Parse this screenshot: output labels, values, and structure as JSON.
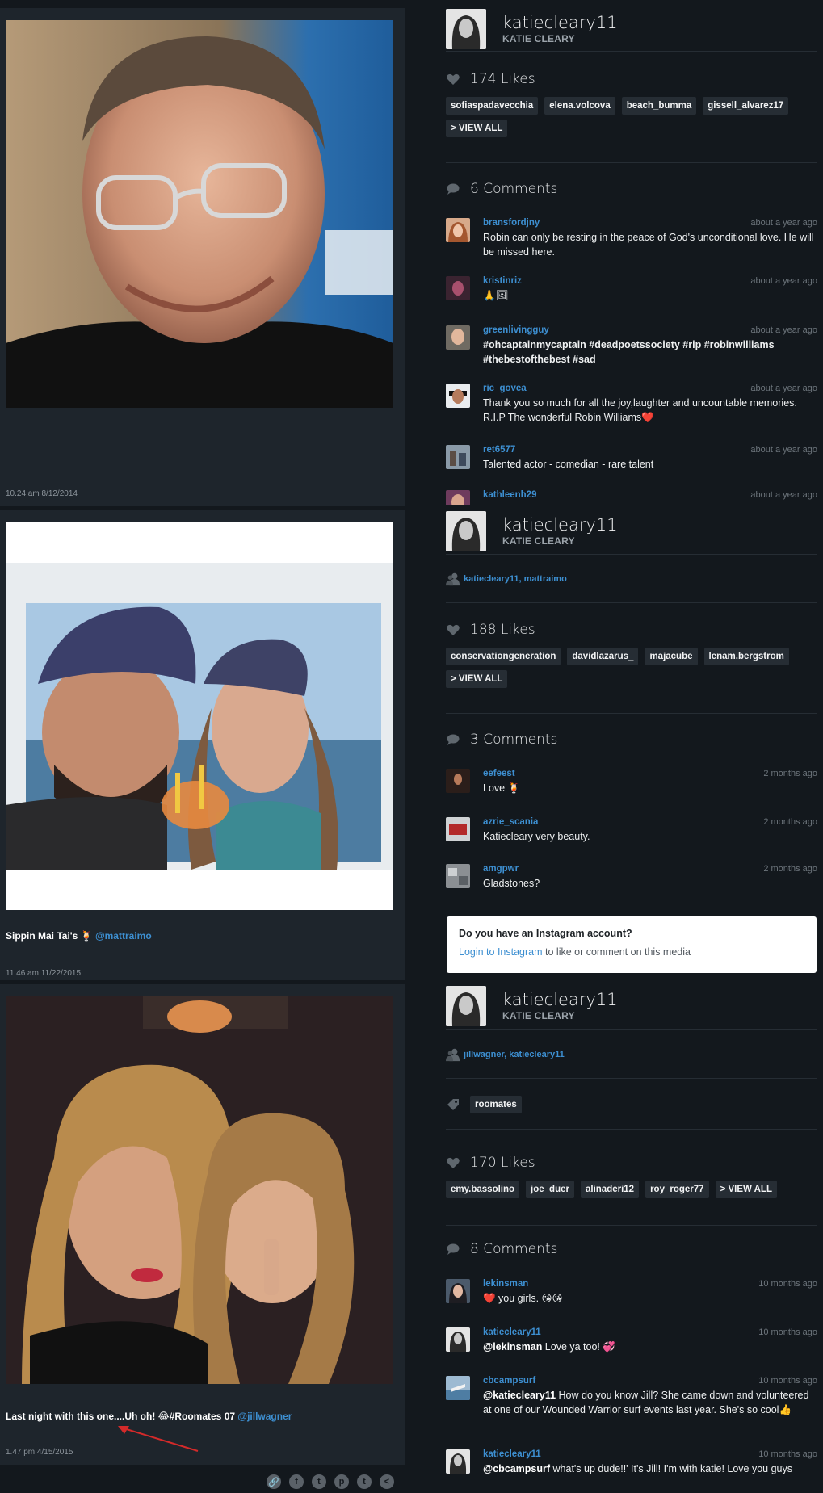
{
  "posts": [
    {
      "photo_alt": "Robin Williams portrait",
      "caption_text": "",
      "caption_mention": "",
      "timestamp": "10.24 am 8/12/2014",
      "profile": {
        "username": "katiecleary11",
        "fullname": "KATIE CLEARY"
      },
      "tagged_people": "",
      "tags": [],
      "likes_label": "174 Likes",
      "likers": [
        "sofiaspadavecchia",
        "elena.volcova",
        "beach_bumma",
        "gissell_alvarez17"
      ],
      "view_all": "> VIEW ALL",
      "comments_label": "6 Comments",
      "comments": [
        {
          "user": "bransfordjny",
          "time": "about a year ago",
          "text": "Robin can only be resting in the peace of God's unconditional love. He will be missed here."
        },
        {
          "user": "kristinriz",
          "time": "about a year ago",
          "text": "🙏🖼"
        },
        {
          "user": "greenlivingguy",
          "time": "about a year ago",
          "text": "#ohcaptainmycaptain #deadpoetssociety #rip #robinwilliams #thebestofthebest #sad"
        },
        {
          "user": "ric_govea",
          "time": "about a year ago",
          "text": "Thank you so much for all the joy,laughter and uncountable memories. R.I.P The wonderful Robin Williams❤️"
        },
        {
          "user": "ret6577",
          "time": "about a year ago",
          "text": "Talented actor - comedian - rare talent"
        },
        {
          "user": "kathleenh29",
          "time": "about a year ago",
          "text": ""
        }
      ]
    },
    {
      "photo_alt": "Selfie with mai tai",
      "caption_text": "Sippin Mai Tai's 🍹",
      "caption_mention": "@mattraimo",
      "timestamp": "11.46 am 11/22/2015",
      "profile": {
        "username": "katiecleary11",
        "fullname": "KATIE CLEARY"
      },
      "tagged_people": "katiecleary11, mattraimo",
      "tags": [],
      "likes_label": "188 Likes",
      "likers": [
        "conservationgeneration",
        "davidlazarus_",
        "majacube",
        "lenam.bergstrom"
      ],
      "view_all": "> VIEW ALL",
      "comments_label": "3 Comments",
      "comments": [
        {
          "user": "eefeest",
          "time": "2 months ago",
          "text": "Love 🍹"
        },
        {
          "user": "azrie_scania",
          "time": "2 months ago",
          "text": "Katiecleary very beauty."
        },
        {
          "user": "amgpwr",
          "time": "2 months ago",
          "text": "Gladstones?"
        }
      ],
      "login_prompt": {
        "question": "Do you have an Instagram account?",
        "link": "Login to Instagram",
        "rest": " to like or comment on this media"
      }
    },
    {
      "photo_alt": "Two women selfie",
      "caption_text": "Last night with this one....Uh oh! 😂#Roomates 07",
      "caption_mention": "@jillwagner",
      "timestamp": "1.47 pm 4/15/2015",
      "profile": {
        "username": "katiecleary11",
        "fullname": "KATIE CLEARY"
      },
      "tagged_people": "jillwagner, katiecleary11",
      "tags": [
        "roomates"
      ],
      "likes_label": "170 Likes",
      "likers": [
        "emy.bassolino",
        "joe_duer",
        "alinaderi12",
        "roy_roger77"
      ],
      "view_all": "> VIEW ALL",
      "comments_label": "8 Comments",
      "comments": [
        {
          "user": "lekinsman",
          "time": "10 months ago",
          "text": "❤️ you girls. 😘😘"
        },
        {
          "user": "katiecleary11",
          "time": "10 months ago",
          "mention": "@lekinsman",
          "text": " Love ya too! 💞"
        },
        {
          "user": "cbcampsurf",
          "time": "10 months ago",
          "mention": "@katiecleary11",
          "text": " How do you know Jill? She came down and volunteered at one of our Wounded Warrior surf events last year. She's so cool👍"
        },
        {
          "user": "katiecleary11",
          "time": "10 months ago",
          "mention": "@cbcampsurf",
          "text": " what's up dude!!' It's Jill! I'm with katie! Love you guys"
        }
      ]
    }
  ],
  "share_icons": [
    "link-icon",
    "facebook-icon",
    "twitter-icon",
    "pinterest-icon",
    "tumblr-icon",
    "share-icon"
  ],
  "share_glyphs": [
    "🔗",
    "f",
    "t",
    "p",
    "t",
    "<"
  ],
  "colors": {
    "background": "#13181d",
    "card": "#1e252c",
    "link": "#3d8fd1",
    "tag": "#262d34"
  }
}
